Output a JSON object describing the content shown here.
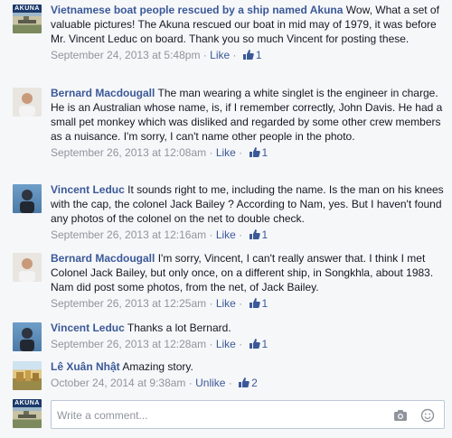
{
  "comments": [
    {
      "author": "Vietnamese boat people rescued by a ship named Akuna",
      "avatar_label": "AKUNA",
      "text": "Wow, What a set of valuable pictures! The Akuna rescued our boat in mid may of 1979, it was before Mr. Vincent Leduc on board. Thank you so much Vincent for posting these.",
      "timestamp": "September 24, 2013 at 5:48pm",
      "like_label": "Like",
      "likes": "1"
    },
    {
      "author": "Bernard Macdougall",
      "text": "The man wearing a white singlet is the engineer in charge. He is an Australian whose name, is, if I remember correctly, John Davis. He had a small pet monkey which was disliked and regarded by some other crew members as a nuisance. I'm sorry, I can't name other people in the photo.",
      "timestamp": "September 26, 2013 at 12:08am",
      "like_label": "Like",
      "likes": "1"
    },
    {
      "author": "Vincent Leduc",
      "text": "It sounds right to me, including the name. Is the man on his knees with the cap, the colonel Jack Bailey ? According to Nam, yes. But I haven't found any photos of the colonel on the net to double check.",
      "timestamp": "September 26, 2013 at 12:16am",
      "like_label": "Like",
      "likes": "1"
    },
    {
      "author": "Bernard Macdougall",
      "text": "I'm sorry, Vincent, I can't really answer that. I think I met Colonel Jack Bailey, but only once, on a different ship, in Songkhla, about 1983. Nam did post some photos, from the net, of Jack Bailey.",
      "timestamp": "September 26, 2013 at 12:25am",
      "like_label": "Like",
      "likes": "1"
    },
    {
      "author": "Vincent Leduc",
      "text": "Thanks a lot Bernard.",
      "timestamp": "September 26, 2013 at 12:28am",
      "like_label": "Like",
      "likes": "1"
    },
    {
      "author": "Lê Xuân Nhật",
      "text": "Amazing story.",
      "timestamp": "October 24, 2014 at 9:38am",
      "like_label": "Unlike",
      "likes": "2"
    }
  ],
  "composer": {
    "avatar_label": "AKUNA",
    "placeholder": "Write a comment...",
    "icons": [
      "camera-icon",
      "emoji-icon"
    ]
  },
  "colors": {
    "link": "#3b5998",
    "meta": "#90949c",
    "background": "#f6f7f9"
  }
}
